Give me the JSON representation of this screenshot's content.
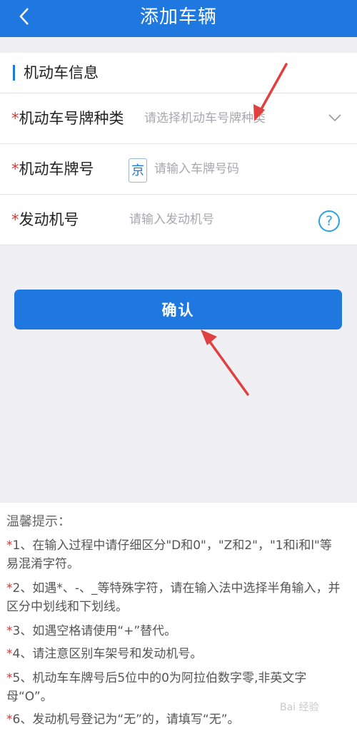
{
  "header": {
    "title": "添加车辆",
    "back_icon": "chevron-left-icon"
  },
  "section": {
    "title": "机动车信息"
  },
  "form": {
    "required_mark": "*",
    "plate_type": {
      "label": "机动车号牌种类",
      "placeholder": "请选择机动车号牌种类"
    },
    "plate_number": {
      "label": "机动车牌号",
      "province": "京",
      "placeholder": "请输入车牌号码"
    },
    "engine_number": {
      "label": "发动机号",
      "placeholder": "请输入发动机号",
      "help": "?"
    }
  },
  "confirm_label": "确认",
  "tips": {
    "title": "温馨提示：",
    "items": [
      {
        "star": "*",
        "text": "1、在输入过程中请仔细区分\"D和0\"，\"Z和2\"，\"1和i和l\"等易混淆字符。"
      },
      {
        "star": "*",
        "text": "2、如遇*、-、_等特殊字符，请在输入法中选择半角输入，并区分中划线和下划线。"
      },
      {
        "star": "*",
        "text": "3、如遇空格请使用“+”替代。"
      },
      {
        "star": "*",
        "text": "4、请注意区别车架号和发动机号。"
      },
      {
        "star": "*",
        "text": "5、机动车车牌号后5位中的0为阿拉伯数字零,非英文字母“O”。"
      },
      {
        "star": "*",
        "text": "6、发动机号登记为“无”的，请填写“无”。"
      }
    ]
  },
  "watermark": "Bai 经验",
  "colors": {
    "primary": "#1e78e0",
    "required": "#e0322f",
    "annotation_arrow": "#e04040"
  }
}
